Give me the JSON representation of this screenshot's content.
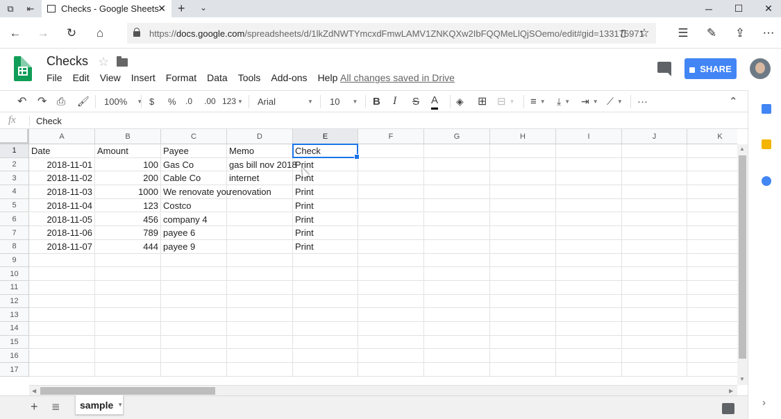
{
  "browser": {
    "tab_title": "Checks - Google Sheets",
    "url_prefix": "https://",
    "url_host": "docs.google.com",
    "url_path": "/spreadsheets/d/1lkZdNWTYmcxdFmwLAMV1ZNKQXw2IbFQQMeLlQjSOemo/edit#gid=133175971"
  },
  "app": {
    "doc_title": "Checks",
    "menus": [
      "File",
      "Edit",
      "View",
      "Insert",
      "Format",
      "Data",
      "Tools",
      "Add-ons",
      "Help"
    ],
    "save_status": "All changes saved in Drive",
    "share_label": "SHARE",
    "brand_color": "#0f9d58",
    "share_color": "#4285f4"
  },
  "toolbar": {
    "zoom": "100%",
    "currency": "$",
    "percent": "%",
    "dec_less": ".0",
    "dec_more": ".00",
    "more_formats": "123",
    "font": "Arial",
    "font_size": "10",
    "bold": "B",
    "italic": "I",
    "strike": "S",
    "text_color": "A",
    "more": "···"
  },
  "formula_bar": {
    "fx": "fx",
    "value": "Check"
  },
  "sheet": {
    "columns": [
      "A",
      "B",
      "C",
      "D",
      "E",
      "F",
      "G",
      "H",
      "I",
      "J",
      "K"
    ],
    "rows": [
      "1",
      "2",
      "3",
      "4",
      "5",
      "6",
      "7",
      "8",
      "9",
      "10",
      "11",
      "12",
      "13",
      "14",
      "15",
      "16",
      "17"
    ],
    "header": [
      "Date",
      "Amount",
      "Payee",
      "Memo",
      "Check"
    ],
    "data": [
      [
        "2018-11-01",
        "100",
        "Gas Co",
        "gas bill nov 2018",
        "Print"
      ],
      [
        "2018-11-02",
        "200",
        "Cable Co",
        "internet",
        "Print"
      ],
      [
        "2018-11-03",
        "1000",
        "We renovate you",
        "renovation",
        "Print"
      ],
      [
        "2018-11-04",
        "123",
        "Costco",
        "",
        "Print"
      ],
      [
        "2018-11-05",
        "456",
        "company 4",
        "",
        "Print"
      ],
      [
        "2018-11-06",
        "789",
        "payee 6",
        "",
        "Print"
      ],
      [
        "2018-11-07",
        "444",
        "payee 9",
        "",
        "Print"
      ]
    ],
    "selected_cell": "E1",
    "active_tab": "sample"
  }
}
